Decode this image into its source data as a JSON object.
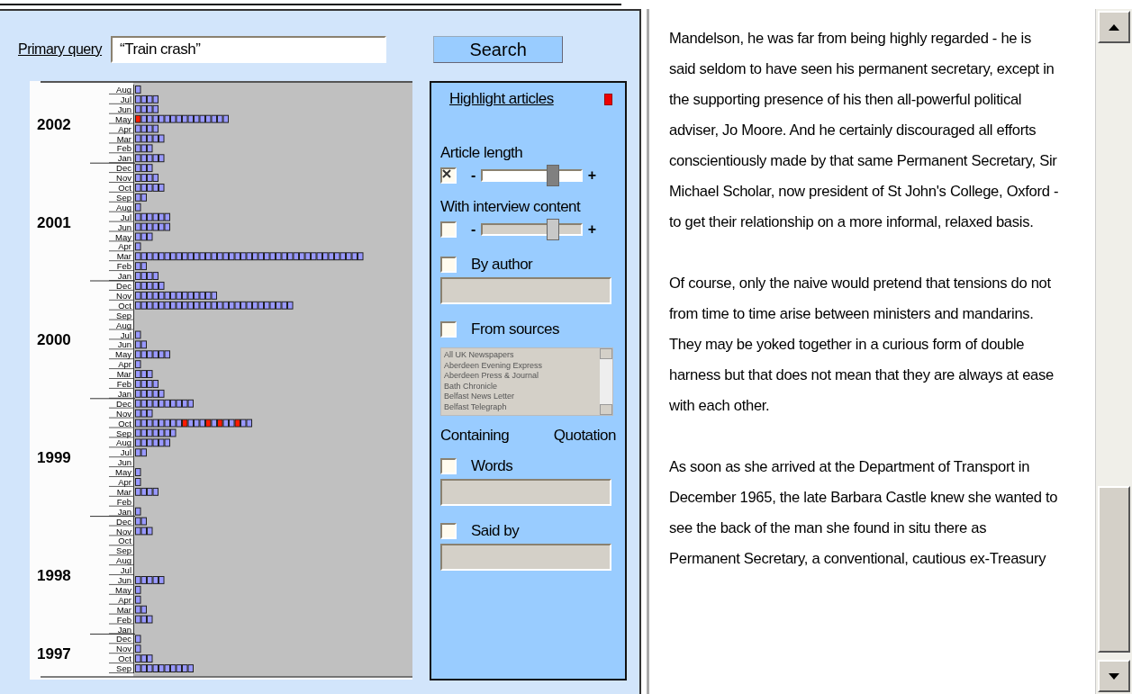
{
  "query": {
    "label": "Primary query",
    "value": "“Train crash”"
  },
  "search_button": "Search",
  "timeline": {
    "years": [
      {
        "label": "2002",
        "months": [
          {
            "label": "Aug",
            "articles": [
              {
                "highlighted": false
              }
            ]
          },
          {
            "label": "Jul",
            "articles": [
              {
                "highlighted": false
              },
              {
                "highlighted": false
              },
              {
                "highlighted": false
              },
              {
                "highlighted": false
              }
            ]
          },
          {
            "label": "Jun",
            "articles": [
              {
                "highlighted": false
              },
              {
                "highlighted": false
              },
              {
                "highlighted": false
              },
              {
                "highlighted": false
              }
            ]
          },
          {
            "label": "May",
            "articles": [
              {
                "highlighted": true
              },
              {
                "highlighted": false
              },
              {
                "highlighted": false
              },
              {
                "highlighted": false
              },
              {
                "highlighted": false
              },
              {
                "highlighted": false
              },
              {
                "highlighted": false
              },
              {
                "highlighted": false
              },
              {
                "highlighted": false
              },
              {
                "highlighted": false
              },
              {
                "highlighted": false
              },
              {
                "highlighted": false
              },
              {
                "highlighted": false
              },
              {
                "highlighted": false
              },
              {
                "highlighted": false
              },
              {
                "highlighted": false
              }
            ]
          },
          {
            "label": "Apr",
            "articles": [
              {
                "highlighted": false
              },
              {
                "highlighted": false
              },
              {
                "highlighted": false
              },
              {
                "highlighted": false
              }
            ]
          },
          {
            "label": "Mar",
            "articles": [
              {
                "highlighted": false
              },
              {
                "highlighted": false
              },
              {
                "highlighted": false
              },
              {
                "highlighted": false
              },
              {
                "highlighted": false
              }
            ]
          },
          {
            "label": "Feb",
            "articles": [
              {
                "highlighted": false
              },
              {
                "highlighted": false
              },
              {
                "highlighted": false
              }
            ]
          },
          {
            "label": "Jan",
            "articles": [
              {
                "highlighted": false
              },
              {
                "highlighted": false
              },
              {
                "highlighted": false
              },
              {
                "highlighted": false
              },
              {
                "highlighted": false
              }
            ]
          }
        ]
      },
      {
        "label": "2001",
        "months": [
          {
            "label": "Dec",
            "articles": [
              {
                "highlighted": false
              },
              {
                "highlighted": false
              },
              {
                "highlighted": false
              }
            ]
          },
          {
            "label": "Nov",
            "articles": [
              {
                "highlighted": false
              },
              {
                "highlighted": false
              },
              {
                "highlighted": false
              },
              {
                "highlighted": false
              }
            ]
          },
          {
            "label": "Oct",
            "articles": [
              {
                "highlighted": false
              },
              {
                "highlighted": false
              },
              {
                "highlighted": false
              },
              {
                "highlighted": false
              },
              {
                "highlighted": false
              }
            ]
          },
          {
            "label": "Sep",
            "articles": [
              {
                "highlighted": false
              },
              {
                "highlighted": false
              }
            ]
          },
          {
            "label": "Aug",
            "articles": [
              {
                "highlighted": false
              }
            ]
          },
          {
            "label": "Jul",
            "articles": [
              {
                "highlighted": false
              },
              {
                "highlighted": false
              },
              {
                "highlighted": false
              },
              {
                "highlighted": false
              },
              {
                "highlighted": false
              },
              {
                "highlighted": false
              }
            ]
          },
          {
            "label": "Jun",
            "articles": [
              {
                "highlighted": false
              },
              {
                "highlighted": false
              },
              {
                "highlighted": false
              },
              {
                "highlighted": false
              },
              {
                "highlighted": false
              },
              {
                "highlighted": false
              }
            ]
          },
          {
            "label": "May",
            "articles": [
              {
                "highlighted": false
              },
              {
                "highlighted": false
              },
              {
                "highlighted": false
              }
            ]
          },
          {
            "label": "Apr",
            "articles": [
              {
                "highlighted": false
              }
            ]
          },
          {
            "label": "Mar",
            "articles": [
              {
                "highlighted": false
              },
              {
                "highlighted": false
              },
              {
                "highlighted": false
              },
              {
                "highlighted": false
              },
              {
                "highlighted": false
              },
              {
                "highlighted": false
              },
              {
                "highlighted": false
              },
              {
                "highlighted": false
              },
              {
                "highlighted": false
              },
              {
                "highlighted": false
              },
              {
                "highlighted": false
              },
              {
                "highlighted": false
              },
              {
                "highlighted": false
              },
              {
                "highlighted": false
              },
              {
                "highlighted": false
              },
              {
                "highlighted": false
              },
              {
                "highlighted": false
              },
              {
                "highlighted": false
              },
              {
                "highlighted": false
              },
              {
                "highlighted": false
              },
              {
                "highlighted": false
              },
              {
                "highlighted": false
              },
              {
                "highlighted": false
              },
              {
                "highlighted": false
              },
              {
                "highlighted": false
              },
              {
                "highlighted": false
              },
              {
                "highlighted": false
              },
              {
                "highlighted": false
              },
              {
                "highlighted": false
              },
              {
                "highlighted": false
              },
              {
                "highlighted": false
              },
              {
                "highlighted": false
              },
              {
                "highlighted": false
              },
              {
                "highlighted": false
              },
              {
                "highlighted": false
              },
              {
                "highlighted": false
              },
              {
                "highlighted": false
              },
              {
                "highlighted": false
              },
              {
                "highlighted": false
              }
            ]
          },
          {
            "label": "Feb",
            "articles": [
              {
                "highlighted": false
              },
              {
                "highlighted": false
              }
            ]
          },
          {
            "label": "Jan",
            "articles": [
              {
                "highlighted": false
              },
              {
                "highlighted": false
              },
              {
                "highlighted": false
              },
              {
                "highlighted": false
              }
            ]
          }
        ]
      },
      {
        "label": "2000",
        "months": [
          {
            "label": "Dec",
            "articles": [
              {
                "highlighted": false
              },
              {
                "highlighted": false
              },
              {
                "highlighted": false
              },
              {
                "highlighted": false
              },
              {
                "highlighted": false
              }
            ]
          },
          {
            "label": "Nov",
            "articles": [
              {
                "highlighted": false
              },
              {
                "highlighted": false
              },
              {
                "highlighted": false
              },
              {
                "highlighted": false
              },
              {
                "highlighted": false
              },
              {
                "highlighted": false
              },
              {
                "highlighted": false
              },
              {
                "highlighted": false
              },
              {
                "highlighted": false
              },
              {
                "highlighted": false
              },
              {
                "highlighted": false
              },
              {
                "highlighted": false
              },
              {
                "highlighted": false
              },
              {
                "highlighted": false
              }
            ]
          },
          {
            "label": "Oct",
            "articles": [
              {
                "highlighted": false
              },
              {
                "highlighted": false
              },
              {
                "highlighted": false
              },
              {
                "highlighted": false
              },
              {
                "highlighted": false
              },
              {
                "highlighted": false
              },
              {
                "highlighted": false
              },
              {
                "highlighted": false
              },
              {
                "highlighted": false
              },
              {
                "highlighted": false
              },
              {
                "highlighted": false
              },
              {
                "highlighted": false
              },
              {
                "highlighted": false
              },
              {
                "highlighted": false
              },
              {
                "highlighted": false
              },
              {
                "highlighted": false
              },
              {
                "highlighted": false
              },
              {
                "highlighted": false
              },
              {
                "highlighted": false
              },
              {
                "highlighted": false
              },
              {
                "highlighted": false
              },
              {
                "highlighted": false
              },
              {
                "highlighted": false
              },
              {
                "highlighted": false
              },
              {
                "highlighted": false
              },
              {
                "highlighted": false
              },
              {
                "highlighted": false
              }
            ]
          },
          {
            "label": "Sep"
          },
          {
            "label": "Aug"
          },
          {
            "label": "Jul",
            "articles": [
              {
                "highlighted": false
              }
            ]
          },
          {
            "label": "Jun",
            "articles": [
              {
                "highlighted": false
              },
              {
                "highlighted": false
              }
            ]
          },
          {
            "label": "May",
            "articles": [
              {
                "highlighted": false
              },
              {
                "highlighted": false
              },
              {
                "highlighted": false
              },
              {
                "highlighted": false
              },
              {
                "highlighted": false
              },
              {
                "highlighted": false
              }
            ]
          },
          {
            "label": "Apr",
            "articles": [
              {
                "highlighted": false
              }
            ]
          },
          {
            "label": "Mar",
            "articles": [
              {
                "highlighted": false
              },
              {
                "highlighted": false
              },
              {
                "highlighted": false
              }
            ]
          },
          {
            "label": "Feb",
            "articles": [
              {
                "highlighted": false
              },
              {
                "highlighted": false
              },
              {
                "highlighted": false
              },
              {
                "highlighted": false
              }
            ]
          },
          {
            "label": "Jan",
            "articles": [
              {
                "highlighted": false
              },
              {
                "highlighted": false
              },
              {
                "highlighted": false
              },
              {
                "highlighted": false
              },
              {
                "highlighted": false
              }
            ]
          }
        ]
      },
      {
        "label": "1999",
        "months": [
          {
            "label": "Dec",
            "articles": [
              {
                "highlighted": false
              },
              {
                "highlighted": false
              },
              {
                "highlighted": false
              },
              {
                "highlighted": false
              },
              {
                "highlighted": false
              },
              {
                "highlighted": false
              },
              {
                "highlighted": false
              },
              {
                "highlighted": false
              },
              {
                "highlighted": false
              },
              {
                "highlighted": false
              }
            ]
          },
          {
            "label": "Nov",
            "articles": [
              {
                "highlighted": false
              },
              {
                "highlighted": false
              },
              {
                "highlighted": false
              }
            ]
          },
          {
            "label": "Oct",
            "articles": [
              {
                "highlighted": false
              },
              {
                "highlighted": false
              },
              {
                "highlighted": false
              },
              {
                "highlighted": false
              },
              {
                "highlighted": false
              },
              {
                "highlighted": false
              },
              {
                "highlighted": false
              },
              {
                "highlighted": false
              },
              {
                "highlighted": true
              },
              {
                "highlighted": false
              },
              {
                "highlighted": false
              },
              {
                "highlighted": false
              },
              {
                "highlighted": true
              },
              {
                "highlighted": false
              },
              {
                "highlighted": true
              },
              {
                "highlighted": false
              },
              {
                "highlighted": false
              },
              {
                "highlighted": true
              },
              {
                "highlighted": false
              },
              {
                "highlighted": false
              }
            ]
          },
          {
            "label": "Sep",
            "articles": [
              {
                "highlighted": false
              },
              {
                "highlighted": false
              },
              {
                "highlighted": false
              },
              {
                "highlighted": false
              },
              {
                "highlighted": false
              },
              {
                "highlighted": false
              },
              {
                "highlighted": false
              }
            ]
          },
          {
            "label": "Aug",
            "articles": [
              {
                "highlighted": false
              },
              {
                "highlighted": false
              },
              {
                "highlighted": false
              },
              {
                "highlighted": false
              },
              {
                "highlighted": false
              },
              {
                "highlighted": false
              }
            ]
          },
          {
            "label": "Jul",
            "articles": [
              {
                "highlighted": false
              },
              {
                "highlighted": false
              }
            ]
          },
          {
            "label": "Jun"
          },
          {
            "label": "May",
            "articles": [
              {
                "highlighted": false
              }
            ]
          },
          {
            "label": "Apr",
            "articles": [
              {
                "highlighted": false
              }
            ]
          },
          {
            "label": "Mar",
            "articles": [
              {
                "highlighted": false
              },
              {
                "highlighted": false
              },
              {
                "highlighted": false
              },
              {
                "highlighted": false
              }
            ]
          },
          {
            "label": "Feb"
          },
          {
            "label": "Jan",
            "articles": [
              {
                "highlighted": false
              }
            ]
          }
        ]
      },
      {
        "label": "1998",
        "months": [
          {
            "label": "Dec",
            "articles": [
              {
                "highlighted": false
              },
              {
                "highlighted": false
              }
            ]
          },
          {
            "label": "Nov",
            "articles": [
              {
                "highlighted": false
              },
              {
                "highlighted": false
              },
              {
                "highlighted": false
              }
            ]
          },
          {
            "label": "Oct"
          },
          {
            "label": "Sep"
          },
          {
            "label": "Aug"
          },
          {
            "label": "Jul"
          },
          {
            "label": "Jun",
            "articles": [
              {
                "highlighted": false
              },
              {
                "highlighted": false
              },
              {
                "highlighted": false
              },
              {
                "highlighted": false
              },
              {
                "highlighted": false
              }
            ]
          },
          {
            "label": "May",
            "articles": [
              {
                "highlighted": false
              }
            ]
          },
          {
            "label": "Apr",
            "articles": [
              {
                "highlighted": false
              }
            ]
          },
          {
            "label": "Mar",
            "articles": [
              {
                "highlighted": false
              },
              {
                "highlighted": false
              }
            ]
          },
          {
            "label": "Feb",
            "articles": [
              {
                "highlighted": false
              },
              {
                "highlighted": false
              },
              {
                "highlighted": false
              }
            ]
          },
          {
            "label": "Jan"
          }
        ]
      },
      {
        "label": "1997",
        "months": [
          {
            "label": "Dec",
            "articles": [
              {
                "highlighted": false
              }
            ]
          },
          {
            "label": "Nov",
            "articles": [
              {
                "highlighted": false
              }
            ]
          },
          {
            "label": "Oct",
            "articles": [
              {
                "highlighted": false
              },
              {
                "highlighted": false
              },
              {
                "highlighted": false
              }
            ]
          },
          {
            "label": "Sep",
            "articles": [
              {
                "highlighted": false
              },
              {
                "highlighted": false
              },
              {
                "highlighted": false
              },
              {
                "highlighted": false
              },
              {
                "highlighted": false
              },
              {
                "highlighted": false
              },
              {
                "highlighted": false
              },
              {
                "highlighted": false
              },
              {
                "highlighted": false
              },
              {
                "highlighted": false
              }
            ]
          }
        ]
      }
    ]
  },
  "filters": {
    "title": "Highlight articles",
    "items": [
      {
        "kind": "slider",
        "label": "Article length",
        "checked": true,
        "minus": "-",
        "plus": "+",
        "level": 0.71
      },
      {
        "kind": "slider",
        "label": "With interview content",
        "checked": false,
        "minus": "-",
        "plus": "+",
        "level": 0.71
      },
      {
        "kind": "text",
        "label": "By author",
        "checked": false
      },
      {
        "kind": "list",
        "label": "From sources",
        "checked": false,
        "options": [
          "All UK Newspapers",
          "Aberdeen Evening Express",
          "Aberdeen Press & Journal",
          "Bath Chronicle",
          "Belfast News Letter",
          "Belfast Telegraph"
        ]
      },
      {
        "kind": "heading",
        "labels": [
          "Containing",
          "Quotation"
        ]
      },
      {
        "kind": "text",
        "label": "Words",
        "checked": false
      },
      {
        "kind": "text",
        "label": "Said by",
        "checked": false
      }
    ]
  },
  "article": {
    "paragraphs": [
      "Mandelson, he was far from being highly regarded - he is said seldom to have seen his permanent secretary, except in the supporting presence of his then all-powerful political adviser, Jo Moore. And he certainly discouraged all efforts conscientiously made by that same Permanent Secretary, Sir Michael Scholar, now president of St John's College, Oxford - to get their relationship on a more informal, relaxed basis.",
      "Of course, only the naive would pretend that tensions do not from time to time arise between ministers and mandarins. They may be yoked together in a curious form of double harness but that does not mean that they are always at ease with each other.",
      "As soon as she arrived at the Department of Transport in December 1965, the late Barbara Castle knew she wanted to see the back of the man she found in situ there as Permanent Secretary, a conventional, cautious ex-Treasury"
    ]
  }
}
